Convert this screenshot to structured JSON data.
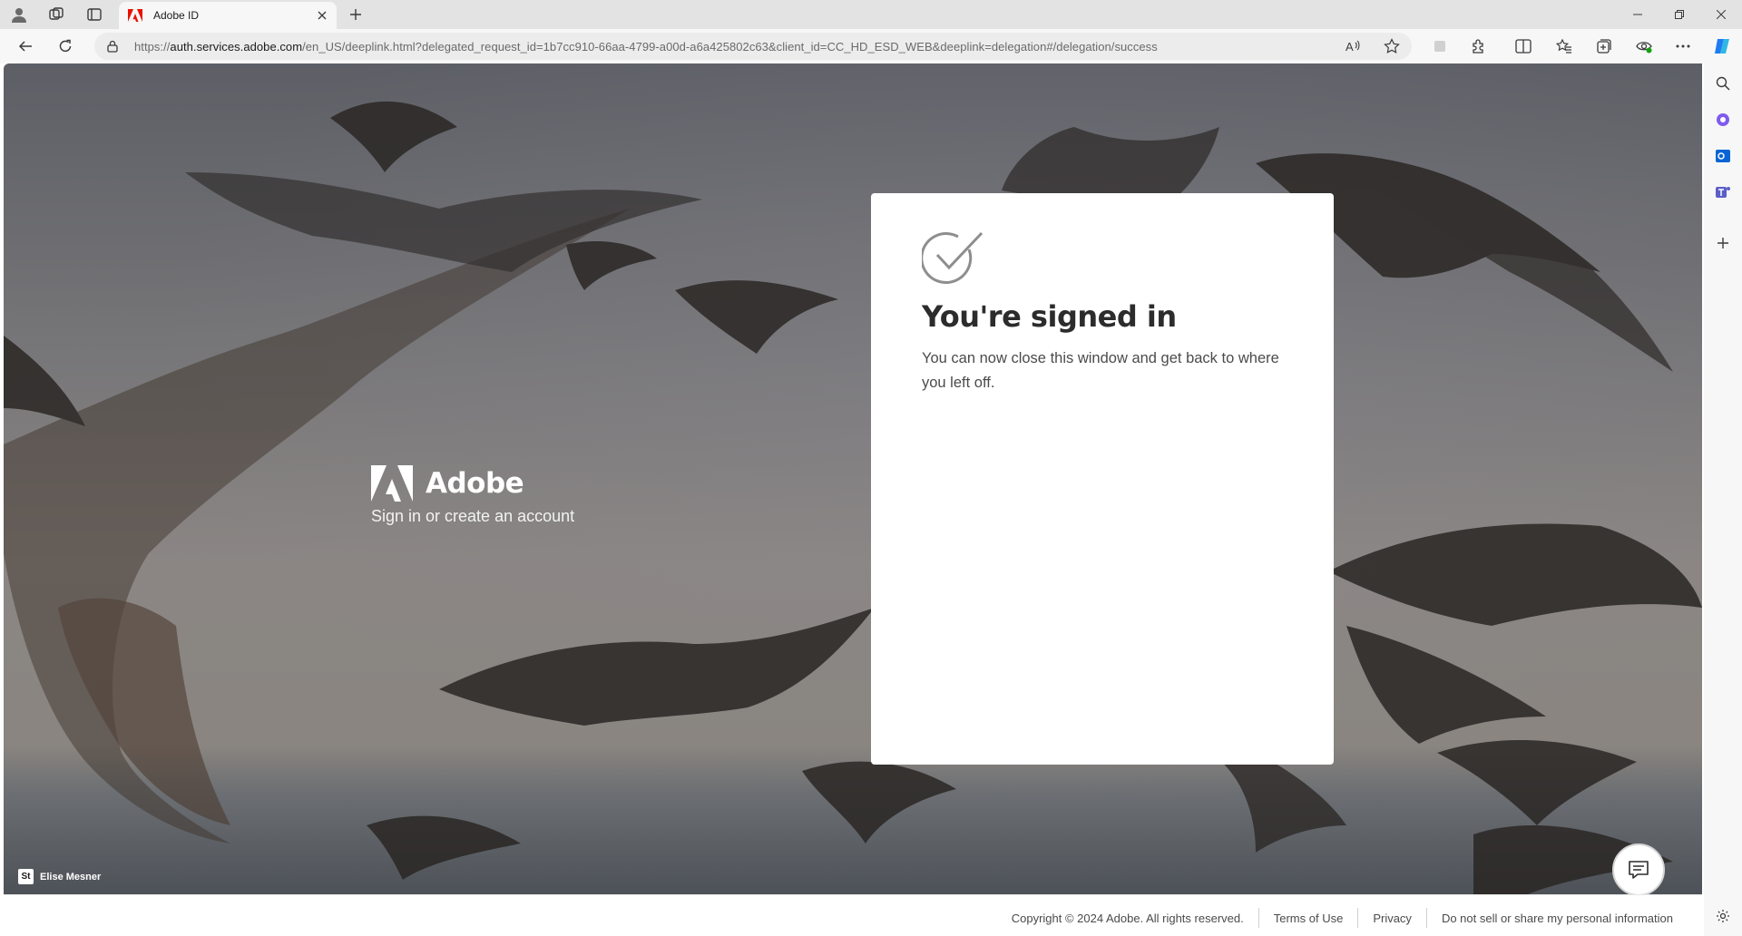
{
  "browser": {
    "tab": {
      "title": "Adobe ID",
      "favicon": "adobe-icon"
    },
    "address": {
      "prefix": "https://",
      "host": "auth.services.adobe.com",
      "path": "/en_US/deeplink.html?delegated_request_id=1b7cc910-66aa-4799-a00d-a6a425802c63&client_id=CC_HD_ESD_WEB&deeplink=delegation#/delegation/success"
    }
  },
  "page": {
    "brand": {
      "name": "Adobe",
      "tagline": "Sign in or create an account"
    },
    "card": {
      "title": "You're signed in",
      "body": "You can now close this window and get back to where you left off."
    },
    "credit": {
      "badge": "St",
      "name": "Elise Mesner"
    },
    "footer": {
      "copyright": "Copyright © 2024 Adobe. All rights reserved.",
      "terms": "Terms of Use",
      "privacy": "Privacy",
      "do_not_sell": "Do not sell or share my personal information"
    }
  },
  "colors": {
    "adobe_red": "#eb1000",
    "card_bg": "#ffffff",
    "copilot_blue": "#1d7cf2"
  }
}
